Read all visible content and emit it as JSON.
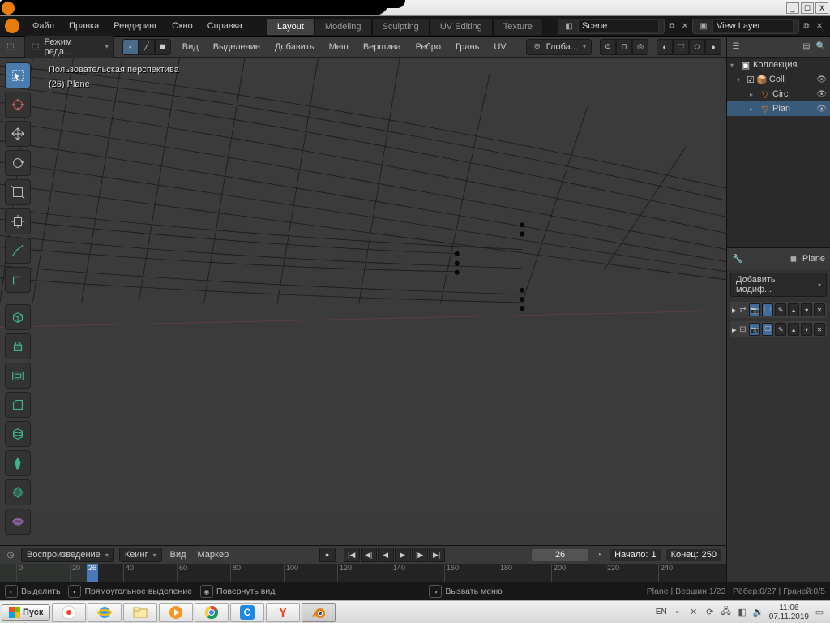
{
  "window": {
    "min": "_",
    "max": "☐",
    "close": "X"
  },
  "topmenu": [
    "Файл",
    "Правка",
    "Рендеринг",
    "Окно",
    "Справка"
  ],
  "workspaces": [
    "Layout",
    "Modeling",
    "Sculpting",
    "UV Editing",
    "Texture"
  ],
  "active_ws": "Layout",
  "scene": {
    "label": "Scene"
  },
  "viewlayer": {
    "label": "View Layer"
  },
  "vp_header": {
    "mode": "Режим реда...",
    "menus": [
      "Вид",
      "Выделение",
      "Добавить",
      "Меш",
      "Вершина",
      "Ребро",
      "Грань",
      "UV"
    ],
    "orient": "Глоба..."
  },
  "overlay": {
    "l1": "Пользовательская перспектива",
    "l2": "(26) Plane"
  },
  "timeline": {
    "playback": "Воспроизведение",
    "keying": "Кеинг",
    "view": "Вид",
    "marker": "Маркер",
    "current": "26",
    "start_lbl": "Начало:",
    "start": "1",
    "end_lbl": "Конец:",
    "end": "250",
    "ticks": [
      "0",
      "20",
      "40",
      "60",
      "80",
      "100",
      "120",
      "140",
      "160",
      "180",
      "200",
      "220",
      "240"
    ]
  },
  "statusbar": {
    "select": "Выделить",
    "box": "Прямоугольное выделение",
    "rotate": "Повернуть вид",
    "menu": "Вызвать меню",
    "stats": "Plane | Вершин:1/23 | Рёбер:0/27 | Граней:0/5"
  },
  "outliner": {
    "title": "Коллекция",
    "items": [
      {
        "name": "Coll",
        "indent": 1,
        "ico": "📦"
      },
      {
        "name": "Circ",
        "indent": 2,
        "ico": "▽"
      },
      {
        "name": "Plan",
        "indent": 2,
        "ico": "▽",
        "sel": true
      }
    ]
  },
  "props": {
    "context": "Plane",
    "add_mod": "Добавить модиф..."
  },
  "taskbar": {
    "start": "Пуск",
    "lang": "EN",
    "clock": {
      "t": "11:06",
      "d": "07.11.2019"
    }
  }
}
